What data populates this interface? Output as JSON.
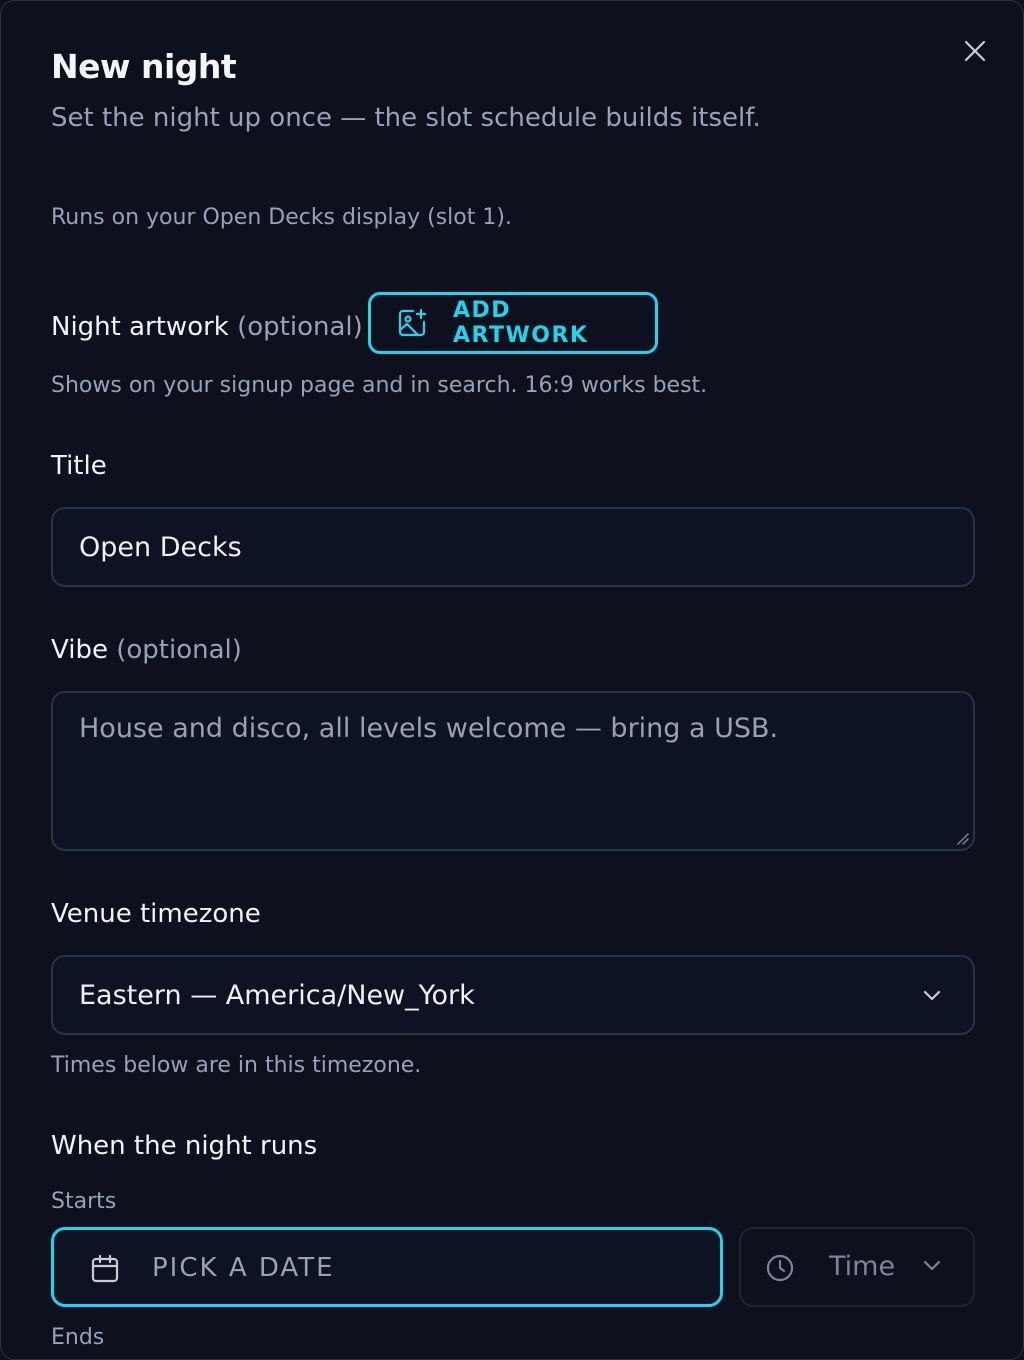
{
  "dialog": {
    "title": "New night",
    "subtitle": "Set the night up once — the slot schedule builds itself.",
    "runs_note": "Runs on your Open Decks display (slot 1)."
  },
  "artwork": {
    "label": "Night artwork",
    "optional": "(optional)",
    "button_label": "ADD ARTWORK",
    "help": "Shows on your signup page and in search. 16:9 works best."
  },
  "title_field": {
    "label": "Title",
    "value": "Open Decks"
  },
  "vibe_field": {
    "label": "Vibe",
    "optional": "(optional)",
    "placeholder": "House and disco, all levels welcome — bring a USB."
  },
  "timezone": {
    "label": "Venue timezone",
    "value": "Eastern — America/New_York",
    "help": "Times below are in this timezone."
  },
  "schedule": {
    "heading": "When the night runs",
    "starts_label": "Starts",
    "date_placeholder": "PICK A DATE",
    "time_placeholder": "Time",
    "ends_label": "Ends"
  },
  "colors": {
    "accent": "#22d3ee",
    "background": "#0c111d",
    "border": "#2a3346",
    "muted_text": "#98a2b3"
  },
  "icons": [
    "close-icon",
    "image-add-icon",
    "chevron-down-icon",
    "calendar-icon",
    "clock-icon",
    "resize-handle-icon"
  ]
}
